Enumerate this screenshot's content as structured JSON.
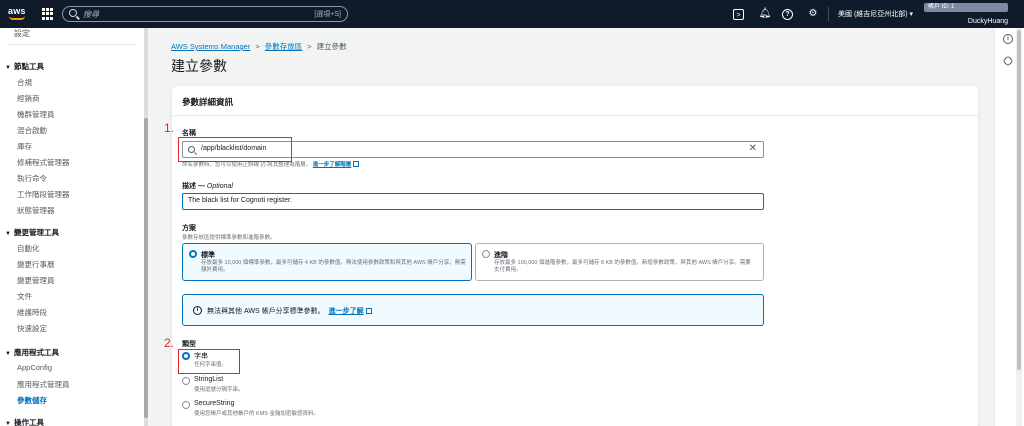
{
  "topbar": {
    "logo_text": "aws",
    "search_placeholder": "搜尋",
    "search_shortcut": "[選項+S]",
    "region_label": "美國 (維吉尼亞州北部) ▾",
    "account_id_label": "帳戶 ID: 1",
    "user_name": "DuckyHuang"
  },
  "sidebar": {
    "cut_item": "設定",
    "sections": [
      {
        "label": "節點工具",
        "items": [
          "合規",
          "經銷商",
          "機群管理員",
          "混合啟動",
          "庫存",
          "修補程式管理器",
          "執行命令",
          "工作階段管理器",
          "狀態管理器"
        ]
      },
      {
        "label": "變更管理工具",
        "items": [
          "自動化",
          "變更行事曆",
          "變更管理員",
          "文件",
          "維護時段",
          "快速設定"
        ]
      },
      {
        "label": "應用程式工具",
        "items": [
          "AppConfig",
          "應用程式管理員",
          "參數儲存"
        ]
      },
      {
        "label": "操作工具",
        "items": []
      }
    ]
  },
  "breadcrumb": {
    "items": [
      "AWS Systems Manager",
      "參數存放區",
      "建立參數"
    ],
    "separator": ">"
  },
  "page": {
    "title": "建立參數"
  },
  "panel": {
    "title": "參數詳細資訊",
    "name": {
      "label": "名稱",
      "value": "/app/blacklist/domain",
      "hint": "命名參數時，您可以使用正斜線 (/) 將其整理為階層。",
      "hint_link": "進一步了解階層"
    },
    "description": {
      "label": "描述 — ",
      "label_optional": "Optional",
      "value": "The black list for Cognoti register."
    },
    "tier": {
      "label": "方案",
      "hint": "參數存放區提供標準參數和進階參數。",
      "options": [
        {
          "title": "標準",
          "desc": "存放最多 10,000 個標準參數，最多可儲存 4 KB 的參數值。無法使用參數政策和與其他 AWS 帳戶分享。無需額外費用。"
        },
        {
          "title": "進階",
          "desc": "存放最多 100,000 個進階參數，最多可儲存 8 KB 的參數值。新增參數政策，與其他 AWS 帳戶分享。需要支付費用。"
        }
      ],
      "info_text": "無法與其他 AWS 帳戶分享標準參數。",
      "info_link": "進一步了解"
    },
    "type": {
      "label": "類型",
      "options": [
        {
          "title": "字串",
          "desc": "任何字串值。"
        },
        {
          "title": "StringList",
          "desc": "使用逗號分隔字串。"
        },
        {
          "title": "SecureString",
          "desc": "使用您帳戶或其他帳戶的 KMS 金鑰加密敏感資料。"
        }
      ]
    }
  },
  "annotations": {
    "step1": "1.",
    "step2": "2."
  },
  "rail": {
    "info_icon": "i"
  },
  "colors": {
    "topbar_bg": "#0f1b2a",
    "link": "#0073bb",
    "annotation_red": "#e0252b",
    "aws_orange": "#ff9900"
  }
}
